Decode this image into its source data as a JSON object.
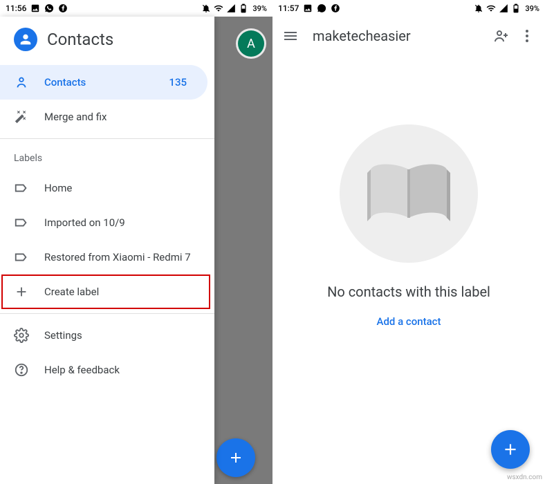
{
  "status_bar": {
    "left": {
      "time": "11:56",
      "time2": "11:57",
      "icons": [
        "image",
        "whatsapp",
        "facebook"
      ]
    },
    "right": {
      "icons": [
        "notifications-off",
        "wifi",
        "signal",
        "battery"
      ],
      "battery_text": "39%"
    }
  },
  "screen1": {
    "avatar_letter": "A",
    "drawer": {
      "title": "Contacts",
      "items": [
        {
          "icon": "person",
          "label": "Contacts",
          "count": "135",
          "active": true
        },
        {
          "icon": "wand",
          "label": "Merge and fix"
        }
      ],
      "labels_title": "Labels",
      "labels": [
        {
          "icon": "label",
          "label": "Home"
        },
        {
          "icon": "label",
          "label": "Imported on 10/9"
        },
        {
          "icon": "label",
          "label": "Restored from Xiaomi - Redmi 7"
        }
      ],
      "create_label": {
        "icon": "plus",
        "label": "Create label"
      },
      "footer": [
        {
          "icon": "settings",
          "label": "Settings"
        },
        {
          "icon": "help",
          "label": "Help & feedback"
        }
      ]
    }
  },
  "screen2": {
    "toolbar": {
      "title": "maketecheasier"
    },
    "empty": {
      "message": "No contacts with this label",
      "action": "Add a contact"
    }
  },
  "watermark": "wsxdn.com"
}
